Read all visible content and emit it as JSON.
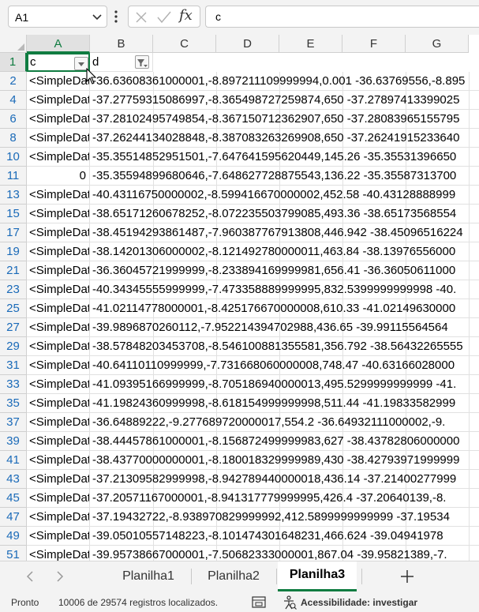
{
  "formula_bar": {
    "name_box": "A1",
    "fx_label": "fx",
    "content": "c"
  },
  "columns": [
    "A",
    "B",
    "C",
    "D",
    "E",
    "F",
    "G"
  ],
  "header_row": {
    "row_number": "1",
    "a": "c",
    "b": "d"
  },
  "rows": [
    {
      "n": "2",
      "a": "<SimpleData",
      "b": "-36.63608361000001,-8.897211109999994,0.001 -36.63769556,-8.895"
    },
    {
      "n": "4",
      "a": "<SimpleData",
      "b": "-37.27759315086997,-8.365498727259874,650 -37.27897413399025"
    },
    {
      "n": "6",
      "a": "<SimpleData",
      "b": "-37.28102495749854,-8.367150712362907,650 -37.28083965155795"
    },
    {
      "n": "8",
      "a": "<SimpleData",
      "b": "-37.26244134028848,-8.387083263269908,650 -37.26241915233640"
    },
    {
      "n": "10",
      "a": "<SimpleData",
      "b": "-35.35514852951501,-7.647641595620449,145.26 -35.35531396650"
    },
    {
      "n": "11",
      "a": "0",
      "b": "-35.35594899680646,-7.648627728875543,136.22 -35.35587313700",
      "numeric": true
    },
    {
      "n": "13",
      "a": "<SimpleData",
      "b": "-40.43116750000002,-8.599416670000002,452.58 -40.43128888999"
    },
    {
      "n": "15",
      "a": "<SimpleData",
      "b": "-38.65171260678252,-8.072235503799085,493.36 -38.65173568554"
    },
    {
      "n": "17",
      "a": "<SimpleData",
      "b": "-38.45194293861487,-7.960387767913808,446.942 -38.45096516224"
    },
    {
      "n": "19",
      "a": "<SimpleData",
      "b": "-38.14201306000002,-8.121492780000011,463.84 -38.13976556000"
    },
    {
      "n": "21",
      "a": "<SimpleData",
      "b": "-36.36045721999999,-8.233894169999981,656.41 -36.36050611000"
    },
    {
      "n": "23",
      "a": "<SimpleData",
      "b": "-40.34345555999999,-7.473358889999995,832.5399999999998 -40."
    },
    {
      "n": "25",
      "a": "<SimpleData",
      "b": "-41.02114778000001,-8.425176670000008,610.33 -41.02149630000"
    },
    {
      "n": "27",
      "a": "<SimpleData",
      "b": "-39.9896870260112,-7.952214394702988,436.65 -39.99115564564"
    },
    {
      "n": "29",
      "a": "<SimpleData",
      "b": "-38.57848203453708,-8.546100881355581,356.792 -38.56432265555"
    },
    {
      "n": "31",
      "a": "<SimpleData",
      "b": "-40.64110110999999,-7.731668060000008,748.47 -40.63166028000"
    },
    {
      "n": "33",
      "a": "<SimpleData",
      "b": "-41.09395166999999,-8.705186940000013,495.5299999999999 -41."
    },
    {
      "n": "35",
      "a": "<SimpleData",
      "b": "-41.19824360999998,-8.618154999999998,511.44 -41.19833582999"
    },
    {
      "n": "37",
      "a": "<SimpleData",
      "b": "-36.64889222,-9.277689720000017,554.2 -36.64932111000002,-9."
    },
    {
      "n": "39",
      "a": "<SimpleData",
      "b": "-38.44457861000001,-8.156872499999983,627 -38.43782806000000"
    },
    {
      "n": "41",
      "a": "<SimpleData",
      "b": "-38.43770000000001,-8.180018329999989,430 -38.42793971999999"
    },
    {
      "n": "43",
      "a": "<SimpleData",
      "b": "-37.21309582999998,-8.942789440000018,436.14 -37.21400277999"
    },
    {
      "n": "45",
      "a": "<SimpleData",
      "b": "-37.20571167000001,-8.941317779999995,426.4 -37.20640139,-8."
    },
    {
      "n": "47",
      "a": "<SimpleData",
      "b": "-37.19432722,-8.938970829999992,412.5899999999999 -37.19534"
    },
    {
      "n": "49",
      "a": "<SimpleData",
      "b": "-39.05010557148223,-8.101474301648231,466.624 -39.04941978"
    },
    {
      "n": "51",
      "a": "<SimpleData",
      "b": "-39.95738667000001,-7.50682333000001,867.04 -39.95821389,-7."
    }
  ],
  "sheet_tabs": [
    {
      "label": "Planilha1",
      "active": false
    },
    {
      "label": "Planilha2",
      "active": false
    },
    {
      "label": "Planilha3",
      "active": true
    }
  ],
  "status_bar": {
    "ready": "Pronto",
    "filter_count": "10006 de 29574 registros localizados.",
    "accessibility": "Acessibilidade: investigar"
  },
  "colors": {
    "accent": "#107c41",
    "row_number_filtered": "#1a6ab8"
  },
  "icons": [
    "chevron-down-icon",
    "more-options-icon",
    "cancel-icon",
    "enter-icon",
    "fx-icon",
    "filter-icon",
    "filter-active-icon",
    "scroll-left-icon",
    "scroll-right-icon",
    "add-sheet-icon",
    "page-layout-icon",
    "accessibility-icon",
    "mouse-cursor-icon"
  ]
}
